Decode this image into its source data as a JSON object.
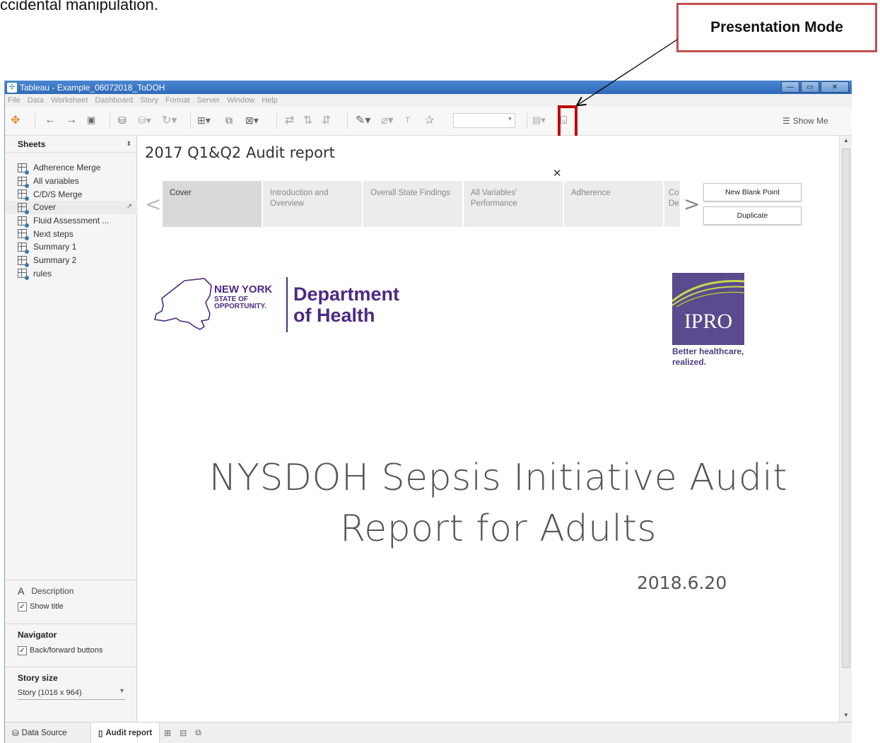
{
  "doc_fragment": "ccidental manipulation.",
  "callout": {
    "label": "Presentation Mode"
  },
  "window": {
    "title": "Tableau - Example_06072018_ToDOH",
    "buttons": {
      "minimize": "—",
      "maximize": "▭",
      "close": "✕"
    }
  },
  "menu": [
    "File",
    "Data",
    "Worksheet",
    "Dashboard",
    "Story",
    "Format",
    "Server",
    "Window",
    "Help"
  ],
  "toolbar": {
    "show_me": "Show Me"
  },
  "sidebar": {
    "sheets_title": "Sheets",
    "sheets": [
      {
        "label": "Adherence Merge"
      },
      {
        "label": "All variables"
      },
      {
        "label": "C/D/S Merge"
      },
      {
        "label": "Cover"
      },
      {
        "label": "Fluid Assessment ..."
      },
      {
        "label": "Next steps"
      },
      {
        "label": "Summary 1"
      },
      {
        "label": "Summary 2"
      },
      {
        "label": "rules"
      }
    ],
    "description_label": "Description",
    "show_title_label": "Show title",
    "navigator_title": "Navigator",
    "back_forward_label": "Back/forward buttons",
    "story_size_title": "Story size",
    "story_size_value": "Story (1016 x 964)"
  },
  "story": {
    "title": "2017 Q1&Q2 Audit report",
    "points": [
      {
        "label": "Cover"
      },
      {
        "label": "Introduction and Overview"
      },
      {
        "label": "Overall State Findings"
      },
      {
        "label": "All Variables' Performance"
      },
      {
        "label": "Adherence"
      },
      {
        "label": "Co De"
      }
    ],
    "new_blank_point": "New Blank Point",
    "duplicate": "Duplicate"
  },
  "cover": {
    "ny_line1": "NEW YORK",
    "ny_line2": "STATE OF",
    "ny_line3": "OPPORTUNITY.",
    "dept_line1": "Department",
    "dept_line2": "of Health",
    "ipro_word": "IPRO",
    "ipro_tag1": "Better healthcare,",
    "ipro_tag2": "realized.",
    "title_line1": "NYSDOH Sepsis Initiative Audit",
    "title_line2": "Report for Adults",
    "date": "2018.6.20"
  },
  "tabs": {
    "data_source": "Data Source",
    "story": "Audit report"
  },
  "colors": {
    "highlight": "#c00000",
    "nys_purple": "#4b2a83",
    "ipro_purple": "#5b4a8e",
    "callout_border": "#c0504d"
  }
}
